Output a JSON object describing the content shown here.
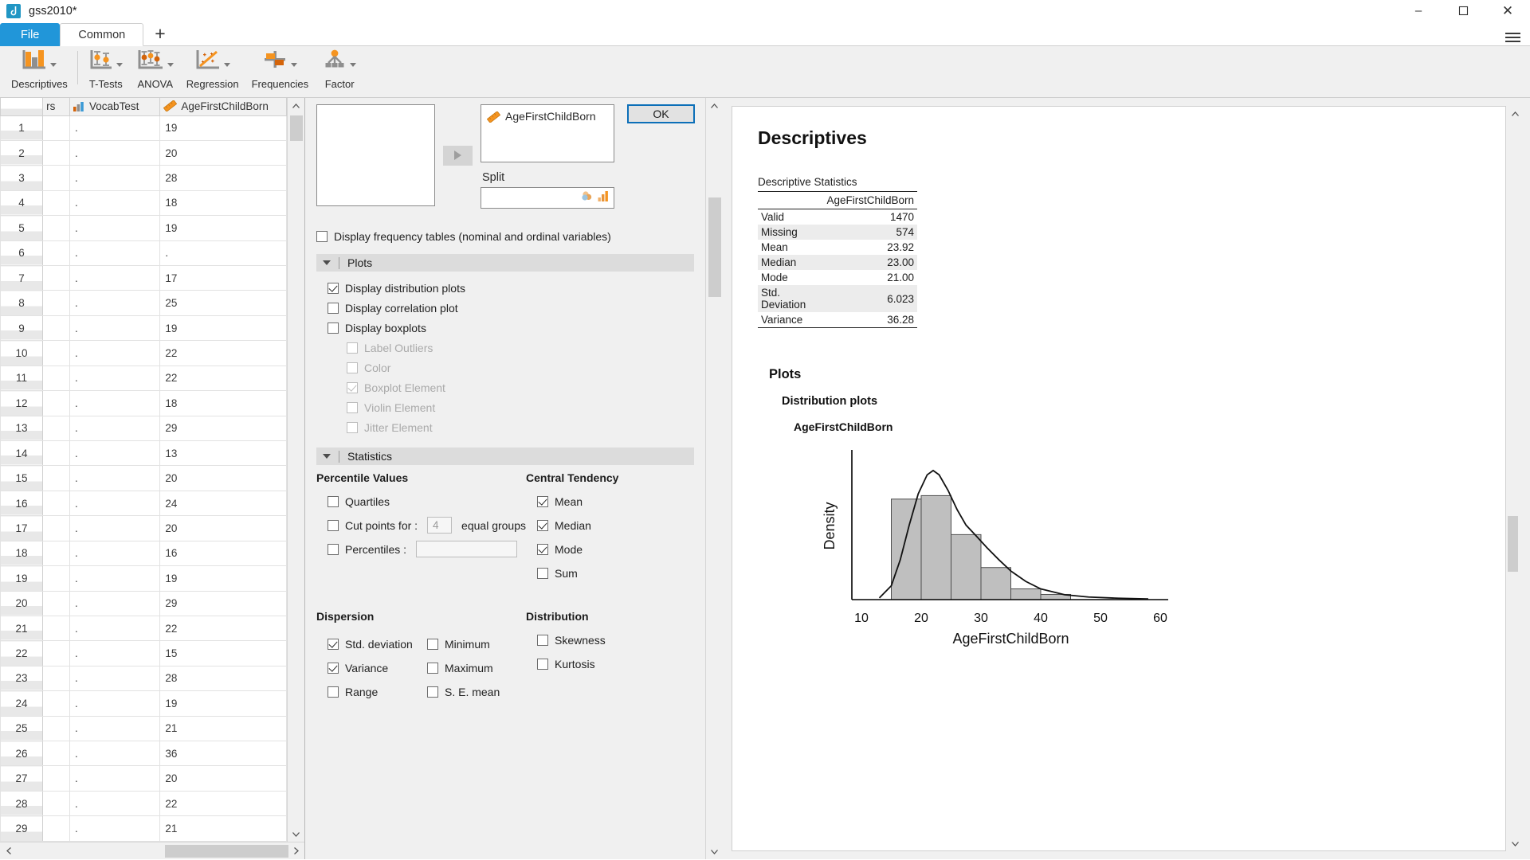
{
  "window": {
    "title": "gss2010*",
    "app_icon": "jasp-icon",
    "minimize": "–",
    "maximize": "❐",
    "close": "✕"
  },
  "ribbon_tabs": {
    "file": "File",
    "common": "Common",
    "add": "+",
    "menu_icon": "hamburger-menu-icon"
  },
  "ribbon": {
    "items": [
      {
        "label": "Descriptives",
        "icon": "bar-chart-icon"
      },
      {
        "label": "T-Tests",
        "icon": "t-test-icon"
      },
      {
        "label": "ANOVA",
        "icon": "anova-icon"
      },
      {
        "label": "Regression",
        "icon": "regression-scatter-icon"
      },
      {
        "label": "Frequencies",
        "icon": "frequencies-cross-icon"
      },
      {
        "label": "Factor",
        "icon": "factor-icon"
      }
    ]
  },
  "datasheet": {
    "columns": [
      {
        "label": "rs",
        "icon": "none"
      },
      {
        "label": "VocabTest",
        "icon": "nominal-icon"
      },
      {
        "label": "AgeFirstChildBorn",
        "icon": "scale-ruler-icon"
      }
    ],
    "rows": [
      {
        "n": "1",
        "c1": "",
        "c2": ".",
        "c3": "19"
      },
      {
        "n": "2",
        "c1": "",
        "c2": ".",
        "c3": "20"
      },
      {
        "n": "3",
        "c1": "",
        "c2": ".",
        "c3": "28"
      },
      {
        "n": "4",
        "c1": "",
        "c2": ".",
        "c3": "18"
      },
      {
        "n": "5",
        "c1": "",
        "c2": ".",
        "c3": "19"
      },
      {
        "n": "6",
        "c1": "",
        "c2": ".",
        "c3": "."
      },
      {
        "n": "7",
        "c1": "",
        "c2": ".",
        "c3": "17"
      },
      {
        "n": "8",
        "c1": "",
        "c2": ".",
        "c3": "25"
      },
      {
        "n": "9",
        "c1": "",
        "c2": ".",
        "c3": "19"
      },
      {
        "n": "10",
        "c1": "",
        "c2": ".",
        "c3": "22"
      },
      {
        "n": "11",
        "c1": "",
        "c2": ".",
        "c3": "22"
      },
      {
        "n": "12",
        "c1": "",
        "c2": ".",
        "c3": "18"
      },
      {
        "n": "13",
        "c1": "",
        "c2": ".",
        "c3": "29"
      },
      {
        "n": "14",
        "c1": "",
        "c2": ".",
        "c3": "13"
      },
      {
        "n": "15",
        "c1": "",
        "c2": ".",
        "c3": "20"
      },
      {
        "n": "16",
        "c1": "",
        "c2": ".",
        "c3": "24"
      },
      {
        "n": "17",
        "c1": "",
        "c2": ".",
        "c3": "20"
      },
      {
        "n": "18",
        "c1": "",
        "c2": ".",
        "c3": "16"
      },
      {
        "n": "19",
        "c1": "",
        "c2": ".",
        "c3": "19"
      },
      {
        "n": "20",
        "c1": "",
        "c2": ".",
        "c3": "29"
      },
      {
        "n": "21",
        "c1": "",
        "c2": ".",
        "c3": "22"
      },
      {
        "n": "22",
        "c1": "",
        "c2": ".",
        "c3": "15"
      },
      {
        "n": "23",
        "c1": "",
        "c2": ".",
        "c3": "28"
      },
      {
        "n": "24",
        "c1": "",
        "c2": ".",
        "c3": "19"
      },
      {
        "n": "25",
        "c1": "",
        "c2": ".",
        "c3": "21"
      },
      {
        "n": "26",
        "c1": "",
        "c2": ".",
        "c3": "36"
      },
      {
        "n": "27",
        "c1": "",
        "c2": ".",
        "c3": "20"
      },
      {
        "n": "28",
        "c1": "",
        "c2": ".",
        "c3": "22"
      },
      {
        "n": "29",
        "c1": "",
        "c2": ".",
        "c3": "21"
      }
    ]
  },
  "options": {
    "assigned_variable": "AgeFirstChildBorn",
    "assigned_variable_icon": "scale-ruler-icon",
    "assign_button_icon": "arrow-right-icon",
    "split_label": "Split",
    "split_value": "",
    "split_icons": [
      "nominal-dot-icon",
      "bar-chart-small-icon"
    ],
    "ok_label": "OK",
    "display_frequency_tables": {
      "label": "Display frequency tables (nominal and ordinal variables)",
      "checked": false
    },
    "plots_section": {
      "title": "Plots",
      "items": [
        {
          "label": "Display distribution plots",
          "checked": true,
          "disabled": false,
          "indent": 0
        },
        {
          "label": "Display correlation plot",
          "checked": false,
          "disabled": false,
          "indent": 0
        },
        {
          "label": "Display boxplots",
          "checked": false,
          "disabled": false,
          "indent": 0
        },
        {
          "label": "Label Outliers",
          "checked": false,
          "disabled": true,
          "indent": 1
        },
        {
          "label": "Color",
          "checked": false,
          "disabled": true,
          "indent": 1
        },
        {
          "label": "Boxplot Element",
          "checked": true,
          "disabled": true,
          "indent": 1
        },
        {
          "label": "Violin Element",
          "checked": false,
          "disabled": true,
          "indent": 1
        },
        {
          "label": "Jitter Element",
          "checked": false,
          "disabled": true,
          "indent": 1
        }
      ]
    },
    "statistics_section": {
      "title": "Statistics",
      "percentile_values": {
        "header": "Percentile Values",
        "quartiles": {
          "label": "Quartiles",
          "checked": false
        },
        "cut_points": {
          "label": "Cut points for :",
          "checked": false,
          "value": "4",
          "suffix": "equal groups"
        },
        "percentiles": {
          "label": "Percentiles :",
          "checked": false,
          "value": ""
        }
      },
      "central_tendency": {
        "header": "Central Tendency",
        "items": [
          {
            "label": "Mean",
            "checked": true
          },
          {
            "label": "Median",
            "checked": true
          },
          {
            "label": "Mode",
            "checked": true
          },
          {
            "label": "Sum",
            "checked": false
          }
        ]
      },
      "dispersion": {
        "header": "Dispersion",
        "left": [
          {
            "label": "Std. deviation",
            "checked": true
          },
          {
            "label": "Variance",
            "checked": true
          },
          {
            "label": "Range",
            "checked": false
          }
        ],
        "right": [
          {
            "label": "Minimum",
            "checked": false
          },
          {
            "label": "Maximum",
            "checked": false
          },
          {
            "label": "S. E. mean",
            "checked": false
          }
        ]
      },
      "distribution": {
        "header": "Distribution",
        "items": [
          {
            "label": "Skewness",
            "checked": false
          },
          {
            "label": "Kurtosis",
            "checked": false
          }
        ]
      }
    }
  },
  "results": {
    "title": "Descriptives",
    "table_caption": "Descriptive Statistics",
    "column_header": "AgeFirstChildBorn",
    "rows": [
      {
        "label": "Valid",
        "value": "1470"
      },
      {
        "label": "Missing",
        "value": "574"
      },
      {
        "label": "Mean",
        "value": "23.92"
      },
      {
        "label": "Median",
        "value": "23.00"
      },
      {
        "label": "Mode",
        "value": "21.00"
      },
      {
        "label": "Std. Deviation",
        "value": "6.023"
      },
      {
        "label": "Variance",
        "value": "36.28"
      }
    ],
    "plots_heading": "Plots",
    "distribution_heading": "Distribution plots",
    "variable_heading": "AgeFirstChildBorn"
  },
  "chart_data": {
    "type": "bar",
    "title": "AgeFirstChildBorn",
    "xlabel": "AgeFirstChildBorn",
    "ylabel": "Density",
    "xlim": [
      10,
      60
    ],
    "ylim": [
      0,
      0.085
    ],
    "xticks": [
      "10",
      "20",
      "30",
      "40",
      "50",
      "60"
    ],
    "xtick_values": [
      10,
      20,
      30,
      40,
      50,
      60
    ],
    "grid": false,
    "legend": false,
    "bin_edges": [
      15,
      20,
      25,
      30,
      35,
      40,
      45
    ],
    "bin_centers": [
      17.5,
      22.5,
      27.5,
      32.5,
      37.5,
      42.5
    ],
    "values": [
      0.058,
      0.06,
      0.0375,
      0.0185,
      0.0062,
      0.003
    ],
    "series": [
      {
        "name": "Density curve",
        "type": "line",
        "x": [
          13,
          15,
          16.5,
          18,
          19.5,
          21,
          22,
          23,
          24.5,
          26,
          27.5,
          29,
          31,
          33,
          35,
          37.5,
          40,
          44,
          48,
          53,
          58
        ],
        "y": [
          0.001,
          0.008,
          0.023,
          0.043,
          0.061,
          0.072,
          0.0745,
          0.072,
          0.063,
          0.052,
          0.043,
          0.0375,
          0.03,
          0.023,
          0.0165,
          0.0105,
          0.0062,
          0.0028,
          0.0015,
          0.0008,
          0.0004
        ]
      }
    ]
  }
}
